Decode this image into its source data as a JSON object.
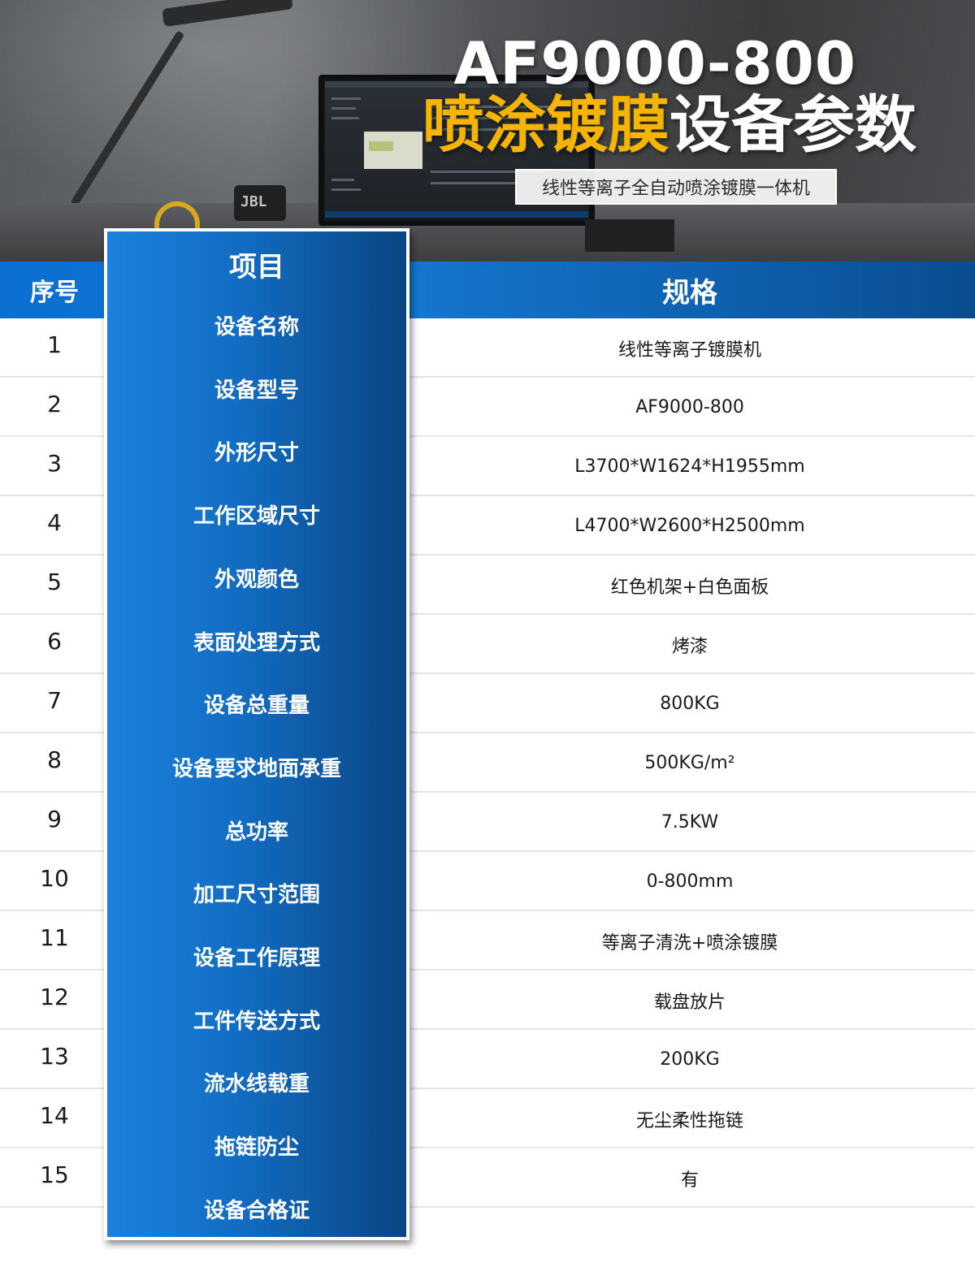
{
  "banner": {
    "title_en": "AF9000-800",
    "title_cn_highlight": "喷涂镀膜",
    "title_cn_rest": "设备参数",
    "subtitle": "线性等离子全自动喷涂镀膜一体机",
    "speaker_brand": "JBL",
    "highlight_color": "#f5b400"
  },
  "table": {
    "header_seq": "序号",
    "header_item": "项目",
    "header_spec": "规格",
    "rows": [
      {
        "seq": "1",
        "item": "设备名称",
        "spec": "线性等离子镀膜机"
      },
      {
        "seq": "2",
        "item": "设备型号",
        "spec": "AF9000-800"
      },
      {
        "seq": "3",
        "item": "外形尺寸",
        "spec": "L3700*W1624*H1955mm"
      },
      {
        "seq": "4",
        "item": "工作区域尺寸",
        "spec": "L4700*W2600*H2500mm"
      },
      {
        "seq": "5",
        "item": "外观颜色",
        "spec": "红色机架+白色面板"
      },
      {
        "seq": "6",
        "item": "表面处理方式",
        "spec": "烤漆"
      },
      {
        "seq": "7",
        "item": "设备总重量",
        "spec": "800KG"
      },
      {
        "seq": "8",
        "item": "设备要求地面承重",
        "spec": "500KG/m²"
      },
      {
        "seq": "9",
        "item": "总功率",
        "spec": "7.5KW"
      },
      {
        "seq": "10",
        "item": "加工尺寸范围",
        "spec": "0-800mm"
      },
      {
        "seq": "11",
        "item": "设备工作原理",
        "spec": "等离子清洗+喷涂镀膜"
      },
      {
        "seq": "12",
        "item": "工件传送方式",
        "spec": "载盘放片"
      },
      {
        "seq": "13",
        "item": "流水线载重",
        "spec": "200KG"
      },
      {
        "seq": "14",
        "item": "拖链防尘",
        "spec": "无尘柔性拖链"
      },
      {
        "seq": "15",
        "item": "设备合格证",
        "spec": "有"
      }
    ]
  },
  "colors": {
    "header_blue": "#0a6fd1",
    "card_blue_dark": "#0a4580",
    "row_divider": "#e3e5e8"
  }
}
